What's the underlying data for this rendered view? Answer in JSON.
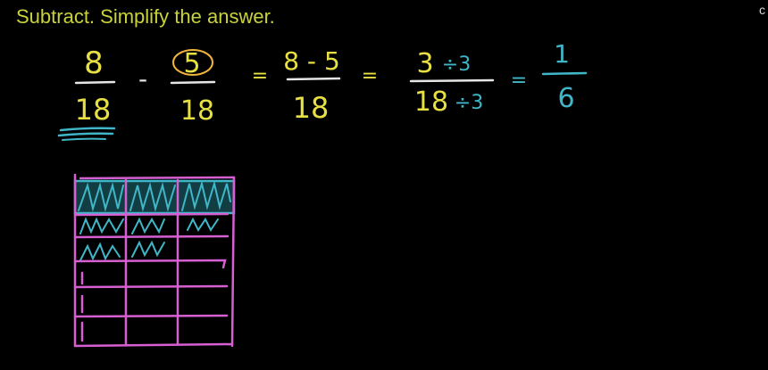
{
  "prompt": "Subtract. Simplify the answer.",
  "corner_text": "c",
  "colors": {
    "background": "#000000",
    "prompt": "#c9d23a",
    "yellow": "#e8e043",
    "orange": "#f0b43c",
    "white_chalk": "#e6e6e6",
    "teal": "#3fb7c9",
    "magenta": "#d65fd1"
  },
  "equation": {
    "frac1": {
      "numerator": "8",
      "denominator": "18"
    },
    "minus": "-",
    "frac2": {
      "numerator": "5",
      "denominator": "18"
    },
    "eq1": "=",
    "frac3": {
      "numerator": "8 - 5",
      "denominator": "18"
    },
    "eq2": "=",
    "frac4": {
      "numerator": "3",
      "numerator_op": "÷3",
      "denominator": "18",
      "denominator_op": "÷3"
    },
    "eq3": "=",
    "frac5": {
      "numerator": "1",
      "denominator": "6"
    }
  },
  "grid": {
    "rows": 6,
    "cols": 3,
    "shaded_teal_rows": 1,
    "shaded_magenta_rows": 2
  }
}
